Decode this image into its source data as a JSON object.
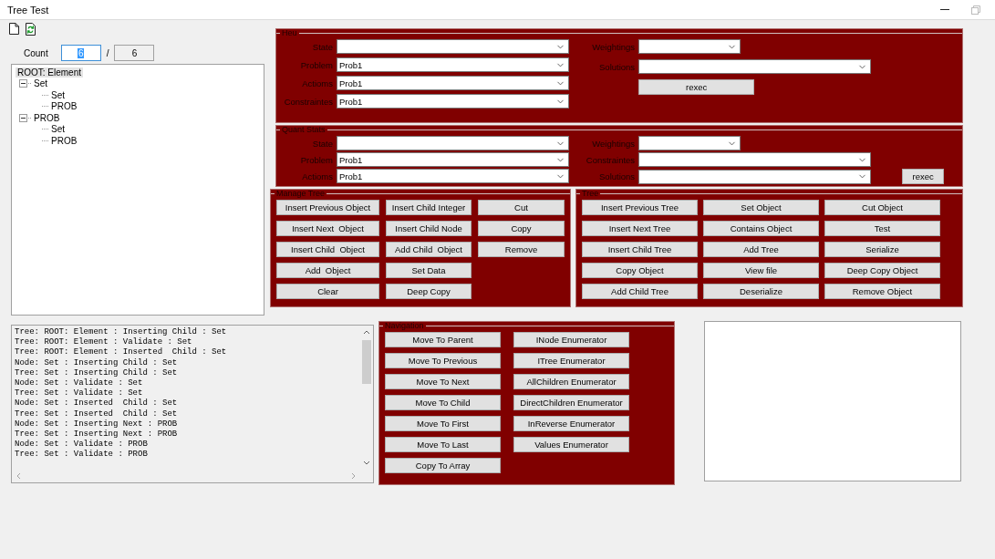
{
  "window": {
    "title": "Tree Test"
  },
  "count": {
    "label": "Count",
    "value": "6",
    "focused": true,
    "separator": "/",
    "total": "6"
  },
  "tree": [
    {
      "label": "ROOT: Element",
      "selected": true,
      "children": [
        {
          "label": "Set",
          "selected": false,
          "expanded": true,
          "children": [
            {
              "label": "Set",
              "selected": false
            },
            {
              "label": "PROB",
              "selected": false
            }
          ]
        },
        {
          "label": "PROB",
          "selected": false,
          "expanded": true,
          "children": [
            {
              "label": "Set",
              "selected": false
            },
            {
              "label": "PROB",
              "selected": false
            }
          ]
        }
      ]
    }
  ],
  "heu": {
    "title": "Heu",
    "left": [
      {
        "label": "State"
      },
      {
        "label": "Problem",
        "value": "Prob1"
      },
      {
        "label": "Actioms",
        "value": "Prob1"
      },
      {
        "label": "Constraintes",
        "value": "Prob1"
      }
    ],
    "right": [
      {
        "label": "Weightings",
        "kind": "short"
      },
      {
        "label": "Solutions",
        "kind": "long"
      }
    ],
    "button": "rexec"
  },
  "quant_stats": {
    "title": "Quant Stats",
    "left": [
      {
        "label": "State"
      },
      {
        "label": "Problem",
        "value": "Prob1"
      },
      {
        "label": "Actioms",
        "value": "Prob1"
      }
    ],
    "right": [
      {
        "label": "Weightings",
        "kind": "short"
      },
      {
        "label": "Constraintes",
        "kind": "long"
      },
      {
        "label": "Solutions",
        "kind": "long"
      }
    ],
    "button": "rexec"
  },
  "manage_tree": {
    "title": "Manage Tree",
    "columns": [
      [
        "Insert Previous Object",
        "Insert Next  Object",
        "Insert Child  Object",
        "Add  Object",
        "Clear"
      ],
      [
        "Insert Child Integer",
        "Insert Child Node",
        "Add Child  Object",
        "Set Data",
        "Deep Copy"
      ],
      [
        "Cut",
        "Copy",
        "Remove"
      ]
    ]
  },
  "tree_group": {
    "title": "Tree",
    "columns": [
      [
        "Insert Previous Tree",
        "Insert Next Tree",
        "Insert Child Tree",
        "Copy Object",
        "Add Child Tree"
      ],
      [
        "Set Object",
        "Contains Object",
        "Add Tree",
        "View file",
        "Deserialize"
      ],
      [
        "Cut Object",
        "Test",
        "Serialize",
        "Deep Copy Object",
        "Remove Object"
      ]
    ]
  },
  "log": [
    "Tree: ROOT: Element : Inserting Child : Set",
    "Tree: ROOT: Element : Validate : Set",
    "Tree: ROOT: Element : Inserted  Child : Set",
    "Node: Set : Inserting Child : Set",
    "Tree: Set : Inserting Child : Set",
    "Node: Set : Validate : Set",
    "Tree: Set : Validate : Set",
    "Node: Set : Inserted  Child : Set",
    "Tree: Set : Inserted  Child : Set",
    "Node: Set : Inserting Next : PROB",
    "Tree: Set : Inserting Next : PROB",
    "Node: Set : Validate : PROB",
    "Tree: Set : Validate : PROB"
  ],
  "navigation": {
    "title": "Navigation",
    "columns": [
      [
        "Move To Parent",
        "Move To Previous",
        "Move To Next",
        "Move To Child",
        "Move To First",
        "Move To Last",
        "Copy To Array"
      ],
      [
        "INode Enumerator",
        "ITree Enumerator",
        "AllChildren Enumerator",
        "DirectChildren Enumerator",
        "InReverse Enumerator",
        "Values Enumerator"
      ]
    ]
  }
}
